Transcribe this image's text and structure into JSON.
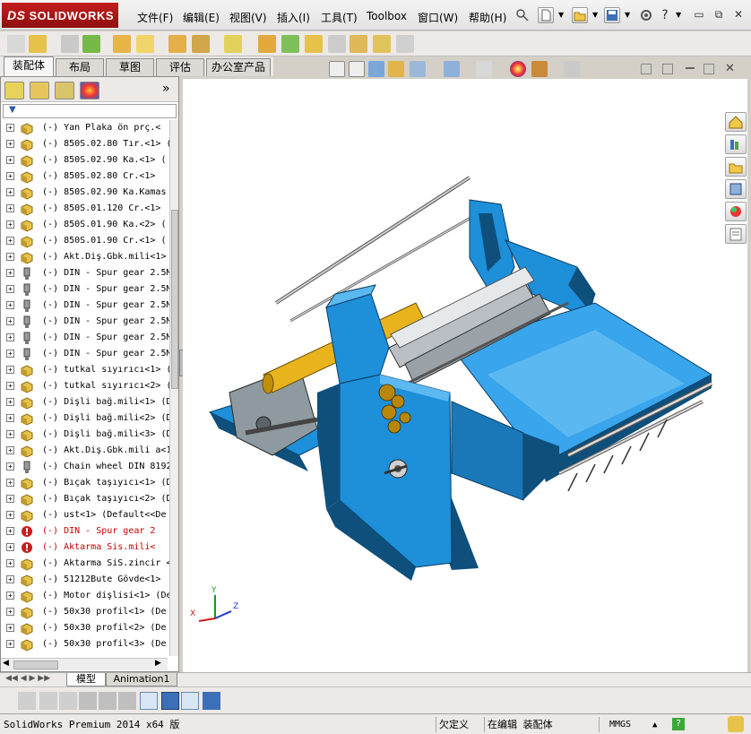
{
  "app": {
    "logo_prefix": "DS",
    "logo_text": "SOLIDWORKS"
  },
  "menu": [
    {
      "label": "文件(F)"
    },
    {
      "label": "编辑(E)"
    },
    {
      "label": "视图(V)"
    },
    {
      "label": "插入(I)"
    },
    {
      "label": "工具(T)"
    },
    {
      "label": "Toolbox"
    },
    {
      "label": "窗口(W)"
    },
    {
      "label": "帮助(H)"
    }
  ],
  "window_controls": {
    "minimize": "▭",
    "restore": "⧉",
    "close": "✕"
  },
  "command_tabs": [
    {
      "label": "装配体",
      "active": true
    },
    {
      "label": "布局"
    },
    {
      "label": "草图"
    },
    {
      "label": "评估"
    },
    {
      "label": "办公室产品"
    }
  ],
  "panel": {
    "collapse_glyph": "»"
  },
  "tree_items": [
    {
      "text": "(-) Yan Plaka  ön prç.<",
      "icon": "part-icon"
    },
    {
      "text": "(-) 850S.02.80 Tır.<1> (",
      "icon": "part-icon"
    },
    {
      "text": "(-) 850S.02.90 Ka.<1> (",
      "icon": "part-icon"
    },
    {
      "text": "(-) 850S.02.80 Cr.<1>",
      "icon": "part-icon"
    },
    {
      "text": "(-) 850S.02.90 Ka.Kamas",
      "icon": "part-icon"
    },
    {
      "text": "(-) 850S.01.120 Cr.<1>",
      "icon": "part-icon"
    },
    {
      "text": "(-) 850S.01.90 Ka.<2> (",
      "icon": "part-icon"
    },
    {
      "text": "(-) 850S.01.90 Cr.<1> (",
      "icon": "part-icon"
    },
    {
      "text": "(-) Akt.Diş.Gbk.mili<1>",
      "icon": "part-icon"
    },
    {
      "text": "(-) DIN - Spur gear 2.5M",
      "icon": "toolbox-icon"
    },
    {
      "text": "(-) DIN - Spur gear 2.5M",
      "icon": "toolbox-icon"
    },
    {
      "text": "(-) DIN - Spur gear 2.5M",
      "icon": "toolbox-icon"
    },
    {
      "text": "(-) DIN - Spur gear 2.5M",
      "icon": "toolbox-icon"
    },
    {
      "text": "(-) DIN - Spur gear 2.5M",
      "icon": "toolbox-icon"
    },
    {
      "text": "(-) DIN - Spur gear 2.5M",
      "icon": "toolbox-icon"
    },
    {
      "text": "(-) tutkal sıyırıcı<1> (De",
      "icon": "part-icon"
    },
    {
      "text": "(-) tutkal sıyırıcı<2> (De",
      "icon": "part-icon"
    },
    {
      "text": "(-) Dişli bağ.mili<1> (D",
      "icon": "part-icon"
    },
    {
      "text": "(-) Dişli bağ.mili<2> (D",
      "icon": "part-icon"
    },
    {
      "text": "(-) Dişli bağ.mili<3> (D",
      "icon": "part-icon"
    },
    {
      "text": "(-) Akt.Diş.Gbk.mili a<1",
      "icon": "part-icon"
    },
    {
      "text": "(-) Chain wheel DIN 8192",
      "icon": "toolbox-icon"
    },
    {
      "text": "(-) Bıçak taşıyıcı<1> (Def",
      "icon": "part-icon"
    },
    {
      "text": "(-) Bıçak taşıyıcı<2> (Def",
      "icon": "part-icon"
    },
    {
      "text": "(-) ust<1> (Default<<De",
      "icon": "part-icon"
    },
    {
      "text": "(-) DIN - Spur gear 2",
      "icon": "error-icon",
      "error": true
    },
    {
      "text": "(-) Aktarma Sis.mili<",
      "icon": "error-icon",
      "error": true
    },
    {
      "text": "(-) Aktarma SiS.zincir <",
      "icon": "part-icon"
    },
    {
      "text": "(-) 51212Bute Gövde<1>",
      "icon": "part-icon"
    },
    {
      "text": "(-) Motor dişlisi<1> (De",
      "icon": "part-icon"
    },
    {
      "text": "(-) 50x30 profil<1> (De",
      "icon": "part-icon"
    },
    {
      "text": "(-) 50x30 profil<2> (De",
      "icon": "part-icon"
    },
    {
      "text": "(-) 50x30 profil<3> (De",
      "icon": "part-icon"
    }
  ],
  "bottom_tabs": [
    {
      "label": "模型",
      "active": true
    },
    {
      "label": "Animation1"
    }
  ],
  "status": {
    "product": "SolidWorks Premium 2014 x64 版",
    "underdefined": "欠定义",
    "editing": "在编辑 装配体",
    "units": "MMGS",
    "units_arrow": "▲",
    "help": "?"
  },
  "triad": {
    "x": "X",
    "y": "Y",
    "z": "Z"
  },
  "colors": {
    "machine_blue": "#1e8fd9",
    "machine_dark": "#0e4f7c",
    "roller_yellow": "#e8b31c",
    "error_red": "#c80000"
  }
}
